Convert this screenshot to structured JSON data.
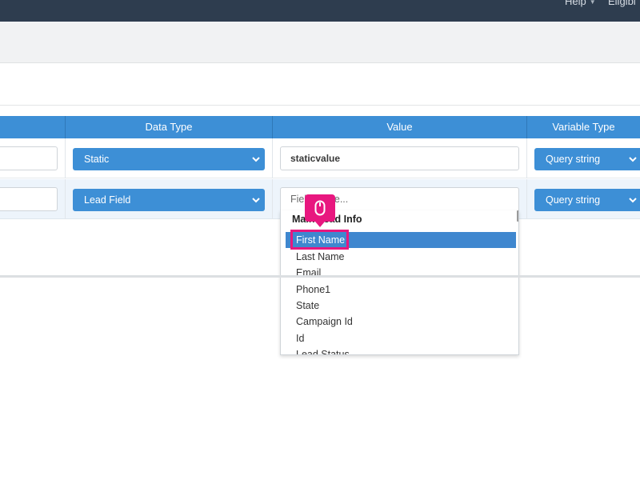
{
  "topbar": {
    "help_label": "Help",
    "eligibility_label": "Eligibi"
  },
  "table": {
    "headers": {
      "data_type": "Data Type",
      "value": "Value",
      "variable_type": "Variable Type"
    },
    "rows": [
      {
        "data_type": "Static",
        "value": "staticvalue",
        "variable_type": "Query string"
      },
      {
        "data_type": "Lead Field",
        "value_placeholder": "Field name...",
        "variable_type": "Query string"
      }
    ]
  },
  "dropdown": {
    "group_label": "Main Lead Info",
    "items": [
      "First Name",
      "Last Name",
      "Email",
      "Phone1",
      "State",
      "Campaign Id",
      "Id",
      "Lead Status"
    ],
    "selected": "First Name"
  },
  "colors": {
    "header_blue": "#3d8fd6",
    "selected_blue": "#3f87cf",
    "highlight_pink": "#e8177f",
    "topbar": "#2e3d4f"
  },
  "icons": [
    "caret-down-icon",
    "chevron-down-icon",
    "mouse-icon"
  ]
}
